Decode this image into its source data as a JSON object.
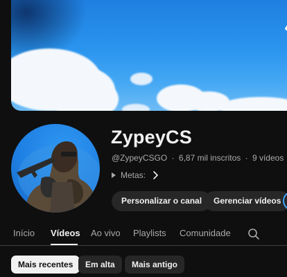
{
  "channel": {
    "name": "ZypeyCS",
    "handle": "@ZypeyCSGO",
    "subscribers": "6,87 mil inscritos",
    "videos": "9 vídeos",
    "separator": "·",
    "metas_label": "Metas:"
  },
  "actions": {
    "customize_label": "Personalizar o canal",
    "manage_label": "Gerenciar vídeos"
  },
  "tabs": [
    {
      "label": "Início",
      "active": false
    },
    {
      "label": "Vídeos",
      "active": true
    },
    {
      "label": "Ao vivo",
      "active": false
    },
    {
      "label": "Playlists",
      "active": false
    },
    {
      "label": "Comunidade",
      "active": false
    }
  ],
  "chips": [
    {
      "label": "Mais recentes",
      "active": true
    },
    {
      "label": "Em alta",
      "active": false
    },
    {
      "label": "Mais antigo",
      "active": false
    }
  ],
  "icons": {
    "tab_search": "search-icon",
    "metas_chevron": "chevron-right-icon",
    "metas_play": "play-icon"
  },
  "colors": {
    "background": "#0f0f0f",
    "surface": "#272727",
    "text_primary": "#f1f1f1",
    "text_secondary": "#aaaaaa",
    "accent": "#3ea6ff",
    "banner_sky": "#2a95ef"
  }
}
